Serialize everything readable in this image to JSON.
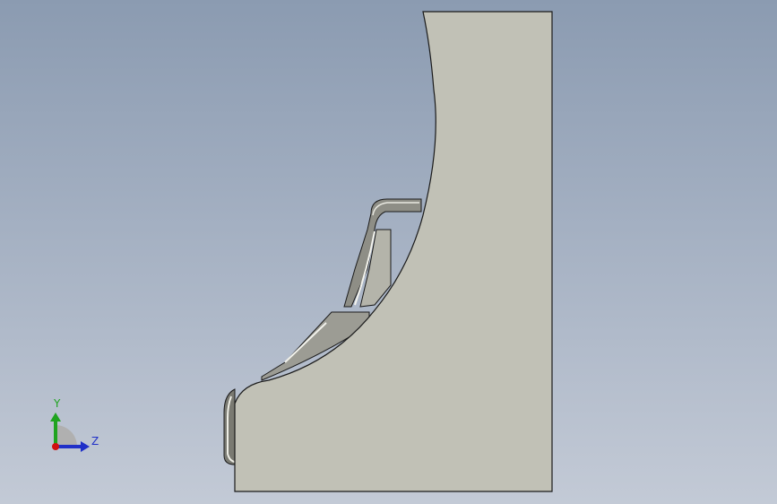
{
  "viewport": {
    "background_top": "#8b9bb1",
    "background_bottom": "#c3cad6"
  },
  "model": {
    "face_color": "#c1c1b6",
    "edge_color": "#1a1a1a",
    "shadow_color": "#707068",
    "highlight_color": "#f4f4ee"
  },
  "triad": {
    "y_label": "Y",
    "z_label": "Z",
    "y_color": "#1fa31f",
    "z_color": "#2030c8",
    "origin_color": "#d01010",
    "quadrant_color": "#b0b0b0"
  }
}
